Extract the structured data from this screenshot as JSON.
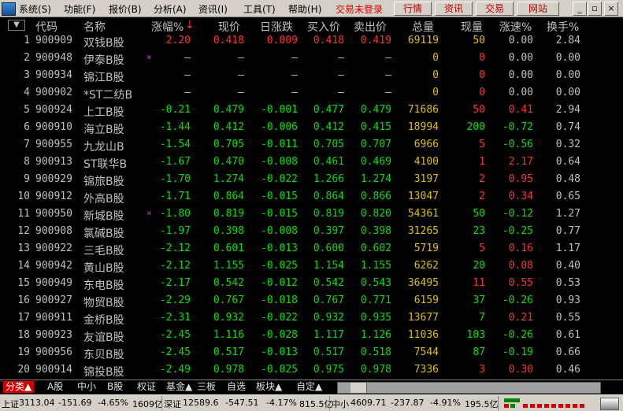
{
  "menubar": {
    "items": [
      "系统(S)",
      "功能(F)",
      "报价(B)",
      "分析(A)",
      "资讯(I)",
      "工具(T)",
      "帮助(H)"
    ],
    "login_status": "交易未登录",
    "buttons": [
      "行情",
      "资讯",
      "交易",
      "网站"
    ],
    "window_controls": [
      "_",
      "▫",
      "×"
    ]
  },
  "table": {
    "sort_indicator": "▼",
    "headers": [
      "代码",
      "名称",
      "涨幅%",
      "现价",
      "日涨跌",
      "买入价",
      "卖出价",
      "总量",
      "现量",
      "涨速%",
      "换手%"
    ],
    "sort_arrow": "↓",
    "rows": [
      {
        "idx": "1",
        "code": "900909",
        "name": "双钱B股",
        "mark": "",
        "pct": "2.20",
        "price": "0.418",
        "chg": "0.009",
        "bid": "0.418",
        "ask": "0.419",
        "vol": "69119",
        "cvol": "50",
        "spd": "0.00",
        "turn": "2.84",
        "color": "red",
        "cvol_color": "yellow",
        "spd_color": "white"
      },
      {
        "idx": "2",
        "code": "900948",
        "name": "伊泰B股",
        "mark": "×",
        "pct": "—",
        "price": "—",
        "chg": "—",
        "bid": "—",
        "ask": "—",
        "vol": "0",
        "cvol": "0",
        "spd": "0.00",
        "turn": "0.00",
        "color": "white",
        "cvol_color": "red",
        "spd_color": "white"
      },
      {
        "idx": "3",
        "code": "900934",
        "name": "锦江B股",
        "mark": "",
        "pct": "—",
        "price": "—",
        "chg": "—",
        "bid": "—",
        "ask": "—",
        "vol": "0",
        "cvol": "0",
        "spd": "0.00",
        "turn": "0.00",
        "color": "white",
        "cvol_color": "red",
        "spd_color": "white"
      },
      {
        "idx": "4",
        "code": "900902",
        "name": "*ST二纺B",
        "mark": "",
        "pct": "—",
        "price": "—",
        "chg": "—",
        "bid": "—",
        "ask": "—",
        "vol": "0",
        "cvol": "0",
        "spd": "0.00",
        "turn": "0.00",
        "color": "white",
        "cvol_color": "red",
        "spd_color": "white"
      },
      {
        "idx": "5",
        "code": "900924",
        "name": "上工B股",
        "mark": "",
        "pct": "-0.21",
        "price": "0.479",
        "chg": "-0.001",
        "bid": "0.477",
        "ask": "0.479",
        "vol": "71686",
        "cvol": "50",
        "spd": "0.41",
        "turn": "2.94",
        "color": "green",
        "cvol_color": "red",
        "spd_color": "red"
      },
      {
        "idx": "6",
        "code": "900910",
        "name": "海立B股",
        "mark": "",
        "pct": "-1.44",
        "price": "0.412",
        "chg": "-0.006",
        "bid": "0.412",
        "ask": "0.415",
        "vol": "18994",
        "cvol": "200",
        "spd": "-0.72",
        "turn": "0.74",
        "color": "green",
        "cvol_color": "green",
        "spd_color": "green"
      },
      {
        "idx": "7",
        "code": "900955",
        "name": "九龙山B",
        "mark": "",
        "pct": "-1.54",
        "price": "0.705",
        "chg": "-0.011",
        "bid": "0.705",
        "ask": "0.707",
        "vol": "6966",
        "cvol": "5",
        "spd": "-0.56",
        "turn": "0.32",
        "color": "green",
        "cvol_color": "red",
        "spd_color": "green"
      },
      {
        "idx": "8",
        "code": "900913",
        "name": "ST联华B",
        "mark": "",
        "pct": "-1.67",
        "price": "0.470",
        "chg": "-0.008",
        "bid": "0.461",
        "ask": "0.469",
        "vol": "4100",
        "cvol": "1",
        "spd": "2.17",
        "turn": "0.64",
        "color": "green",
        "cvol_color": "red",
        "spd_color": "red"
      },
      {
        "idx": "9",
        "code": "900929",
        "name": "锦旅B股",
        "mark": "",
        "pct": "-1.70",
        "price": "1.274",
        "chg": "-0.022",
        "bid": "1.266",
        "ask": "1.274",
        "vol": "3197",
        "cvol": "2",
        "spd": "0.95",
        "turn": "0.48",
        "color": "green",
        "cvol_color": "red",
        "spd_color": "red"
      },
      {
        "idx": "10",
        "code": "900912",
        "name": "外高B股",
        "mark": "",
        "pct": "-1.71",
        "price": "0.864",
        "chg": "-0.015",
        "bid": "0.864",
        "ask": "0.866",
        "vol": "13047",
        "cvol": "2",
        "spd": "0.34",
        "turn": "0.65",
        "color": "green",
        "cvol_color": "red",
        "spd_color": "red"
      },
      {
        "idx": "11",
        "code": "900950",
        "name": "新城B股",
        "mark": "×",
        "pct": "-1.80",
        "price": "0.819",
        "chg": "-0.015",
        "bid": "0.819",
        "ask": "0.820",
        "vol": "54361",
        "cvol": "50",
        "spd": "-0.12",
        "turn": "1.27",
        "color": "green",
        "cvol_color": "green",
        "spd_color": "green"
      },
      {
        "idx": "12",
        "code": "900908",
        "name": "氯碱B股",
        "mark": "",
        "pct": "-1.97",
        "price": "0.398",
        "chg": "-0.008",
        "bid": "0.397",
        "ask": "0.398",
        "vol": "31265",
        "cvol": "23",
        "spd": "-0.25",
        "turn": "0.77",
        "color": "green",
        "cvol_color": "green",
        "spd_color": "green"
      },
      {
        "idx": "13",
        "code": "900922",
        "name": "三毛B股",
        "mark": "",
        "pct": "-2.12",
        "price": "0.601",
        "chg": "-0.013",
        "bid": "0.600",
        "ask": "0.602",
        "vol": "5719",
        "cvol": "5",
        "spd": "0.16",
        "turn": "1.17",
        "color": "green",
        "cvol_color": "red",
        "spd_color": "red"
      },
      {
        "idx": "14",
        "code": "900942",
        "name": "黄山B股",
        "mark": "",
        "pct": "-2.12",
        "price": "1.155",
        "chg": "-0.025",
        "bid": "1.154",
        "ask": "1.155",
        "vol": "6262",
        "cvol": "20",
        "spd": "0.08",
        "turn": "0.40",
        "color": "green",
        "cvol_color": "green",
        "spd_color": "red"
      },
      {
        "idx": "15",
        "code": "900949",
        "name": "东电B股",
        "mark": "",
        "pct": "-2.17",
        "price": "0.542",
        "chg": "-0.012",
        "bid": "0.542",
        "ask": "0.543",
        "vol": "36495",
        "cvol": "11",
        "spd": "0.55",
        "turn": "0.53",
        "color": "green",
        "cvol_color": "red",
        "spd_color": "red"
      },
      {
        "idx": "16",
        "code": "900927",
        "name": "物贸B股",
        "mark": "",
        "pct": "-2.29",
        "price": "0.767",
        "chg": "-0.018",
        "bid": "0.767",
        "ask": "0.771",
        "vol": "6159",
        "cvol": "37",
        "spd": "-0.26",
        "turn": "0.93",
        "color": "green",
        "cvol_color": "green",
        "spd_color": "green"
      },
      {
        "idx": "17",
        "code": "900911",
        "name": "金桥B股",
        "mark": "",
        "pct": "-2.31",
        "price": "0.932",
        "chg": "-0.022",
        "bid": "0.932",
        "ask": "0.935",
        "vol": "13677",
        "cvol": "7",
        "spd": "0.21",
        "turn": "0.55",
        "color": "green",
        "cvol_color": "green",
        "spd_color": "red"
      },
      {
        "idx": "18",
        "code": "900923",
        "name": "友谊B股",
        "mark": "",
        "pct": "-2.45",
        "price": "1.116",
        "chg": "-0.028",
        "bid": "1.117",
        "ask": "1.126",
        "vol": "11036",
        "cvol": "103",
        "spd": "-0.26",
        "turn": "0.61",
        "color": "green",
        "cvol_color": "green",
        "spd_color": "green"
      },
      {
        "idx": "19",
        "code": "900956",
        "name": "东贝B股",
        "mark": "",
        "pct": "-2.45",
        "price": "0.517",
        "chg": "-0.013",
        "bid": "0.517",
        "ask": "0.518",
        "vol": "7544",
        "cvol": "87",
        "spd": "-0.19",
        "turn": "0.66",
        "color": "green",
        "cvol_color": "green",
        "spd_color": "green"
      },
      {
        "idx": "20",
        "code": "900914",
        "name": "锦投B股",
        "mark": "",
        "pct": "-2.49",
        "price": "0.978",
        "chg": "-0.025",
        "bid": "0.975",
        "ask": "0.978",
        "vol": "7336",
        "cvol": "3",
        "spd": "0.30",
        "turn": "0.46",
        "color": "green",
        "cvol_color": "red",
        "spd_color": "red"
      }
    ]
  },
  "tabs": [
    "分类▲",
    "A股",
    "中小",
    "B股",
    "权证",
    "基金▲",
    "三板",
    "自选",
    "板块▲",
    "自定▲"
  ],
  "statusbar": {
    "sh_label": "上证",
    "sh_value": "3113.04",
    "sh_chg": "-151.69",
    "sh_pct": "-4.65%",
    "sh_amt": "1609亿",
    "sz_label": "深证",
    "sz_value": "12589.6",
    "sz_chg": "-547.51",
    "sz_pct": "-4.17%",
    "sz_amt": "815.5亿",
    "zx_label": "中小",
    "zx_value": "4609.71",
    "zx_chg": "-237.87",
    "zx_pct": "-4.91%",
    "zx_amt": "195.5亿"
  },
  "colors": {
    "red": "#ff3030",
    "green": "#00e000",
    "yellow": "#e0c000",
    "header": "#c0c0c0"
  }
}
